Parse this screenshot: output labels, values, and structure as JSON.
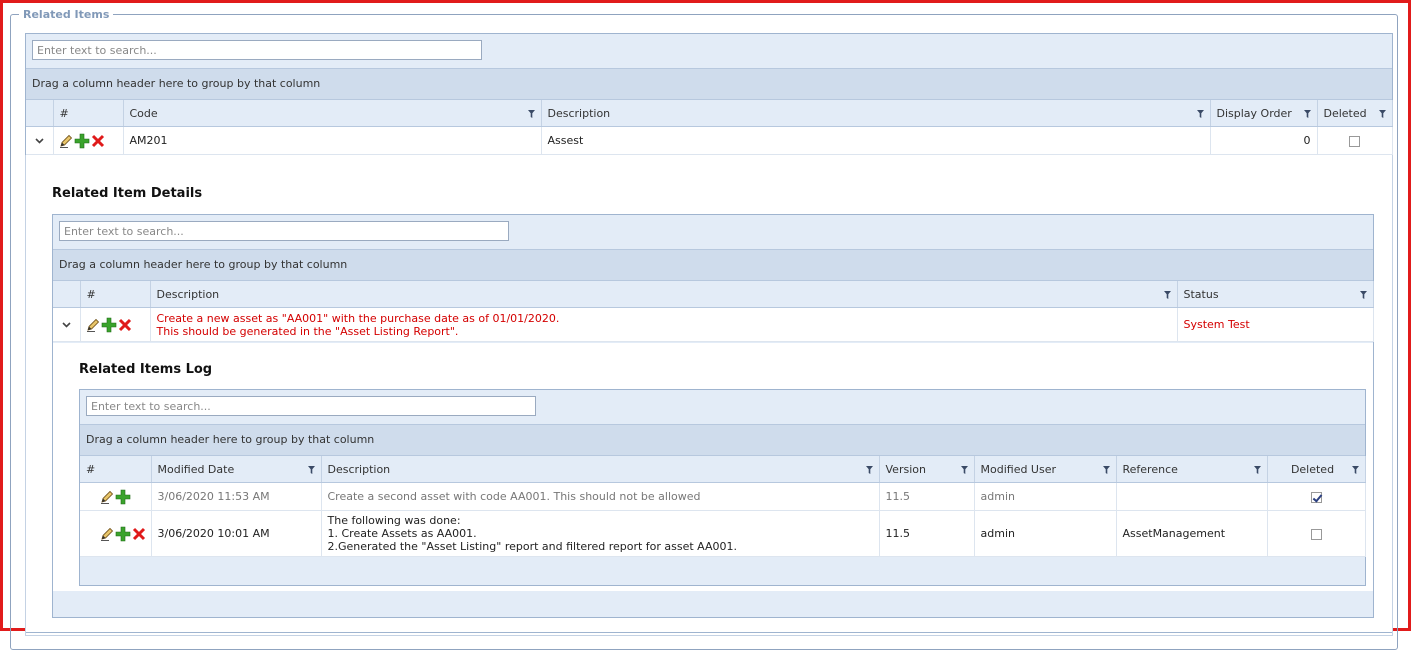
{
  "legend": "Related Items",
  "outer_grid": {
    "search_placeholder": "Enter text to search...",
    "group_hint": "Drag a column header here to group by that column",
    "columns": [
      "#",
      "Code",
      "Description",
      "Display Order",
      "Deleted"
    ],
    "row": {
      "code": "AM201",
      "description": "Assest",
      "display_order": "0",
      "deleted": false
    }
  },
  "details": {
    "title": "Related Item Details",
    "search_placeholder": "Enter text to search...",
    "group_hint": "Drag a column header here to group by that column",
    "columns": [
      "#",
      "Description",
      "Status"
    ],
    "row": {
      "description_line1": "Create a new asset as \"AA001\" with the purchase date as of 01/01/2020.",
      "description_line2": "This should be generated in the \"Asset Listing Report\".",
      "status": "System Test"
    }
  },
  "log": {
    "title": "Related Items Log",
    "search_placeholder": "Enter text to search...",
    "group_hint": "Drag a column header here to group by that column",
    "columns": [
      "#",
      "Modified Date",
      "Description",
      "Version",
      "Modified User",
      "Reference",
      "Deleted"
    ],
    "rows": [
      {
        "modified_date": "3/06/2020 11:53 AM",
        "description": "Create a second asset with code AA001. This should not be allowed",
        "version": "11.5",
        "modified_user": "admin",
        "reference": "",
        "deleted": true
      },
      {
        "modified_date": "3/06/2020 10:01 AM",
        "description_line1": "The following was done:",
        "description_line2": "1. Create Assets as AA001.",
        "description_line3": "2.Generated the \"Asset Listing\" report and filtered report for asset AA001.",
        "version": "11.5",
        "modified_user": "admin",
        "reference": "AssetManagement",
        "deleted": false
      }
    ]
  },
  "colors": {
    "frame": "#e11b1b",
    "header_bg": "#e3ecf7",
    "group_bg": "#cfdcec",
    "status_red": "#d40000"
  }
}
